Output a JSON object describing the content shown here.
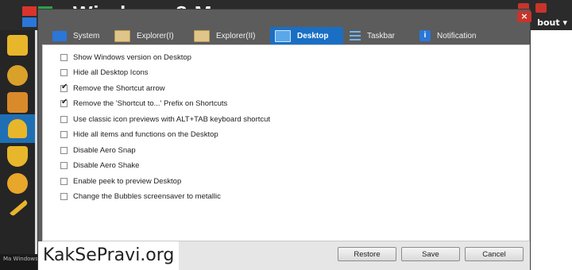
{
  "background_app": {
    "title": "Windows 8 M",
    "about": "bout ▾",
    "status_text": "Ma Windows8Manager"
  },
  "dialog": {
    "close_icon": "close-icon",
    "tabs": [
      {
        "label": "System",
        "icon": "windows-icon",
        "active": false
      },
      {
        "label": "Explorer(I)",
        "icon": "folder-icon",
        "active": false
      },
      {
        "label": "Explorer(II)",
        "icon": "folder-icon",
        "active": false
      },
      {
        "label": "Desktop",
        "icon": "desktop-icon",
        "active": true
      },
      {
        "label": "Taskbar",
        "icon": "list-icon",
        "active": false
      },
      {
        "label": "Notification",
        "icon": "info-icon",
        "active": false
      }
    ],
    "options": [
      {
        "label": "Show Windows version on Desktop",
        "checked": false
      },
      {
        "label": "Hide all Desktop Icons",
        "checked": false
      },
      {
        "label": "Remove the Shortcut arrow",
        "checked": true
      },
      {
        "label": "Remove the 'Shortcut to...' Prefix on Shortcuts",
        "checked": true
      },
      {
        "label": "Use classic icon previews with ALT+TAB keyboard shortcut",
        "checked": false
      },
      {
        "label": "Hide all items and functions on the Desktop",
        "checked": false
      },
      {
        "label": "Disable Aero Snap",
        "checked": false
      },
      {
        "label": "Disable Aero Shake",
        "checked": false
      },
      {
        "label": "Enable peek to preview Desktop",
        "checked": false
      },
      {
        "label": "Change the Bubbles screensaver to metallic",
        "checked": false
      }
    ],
    "buttons": {
      "restore": "Restore",
      "save": "Save",
      "cancel": "Cancel"
    }
  },
  "watermark": "KakSePravi.org",
  "colors": {
    "active_tab": "#1a6fc4",
    "dialog_frame": "#5c5c5c",
    "close_button": "#c8342b"
  }
}
